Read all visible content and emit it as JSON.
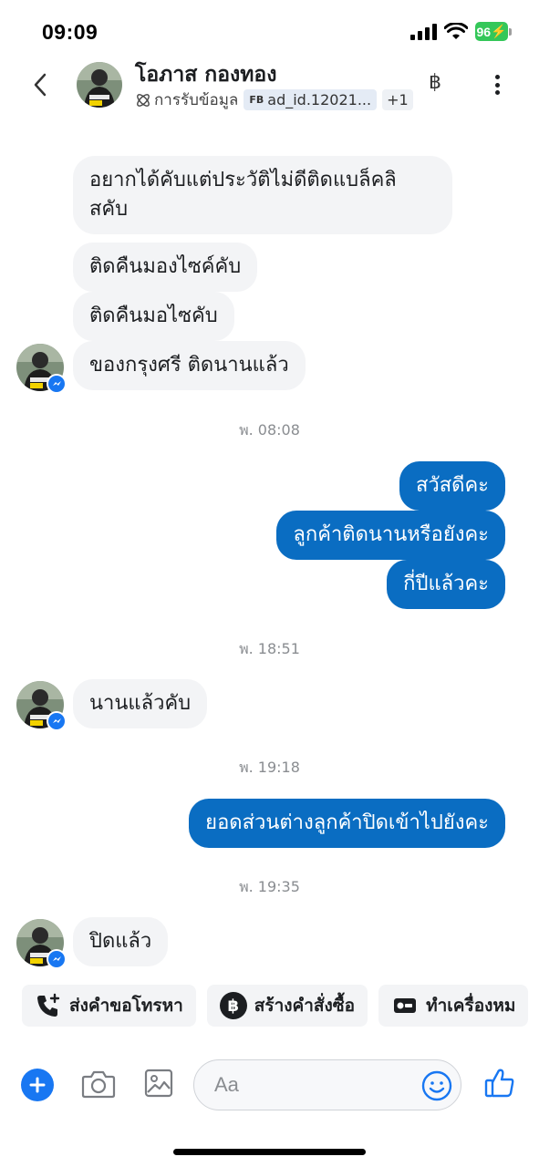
{
  "status_bar": {
    "time": "09:09",
    "battery": "96"
  },
  "header": {
    "contact_name": "โอภาส กองทอง",
    "info_label": "การรับข้อมูล",
    "tag_prefix": "FB",
    "tag_text": "ad_id.12021...",
    "extra_count": "+1",
    "currency_icon": "฿"
  },
  "messages": [
    {
      "side": "in",
      "text_line1": "อยากได้คับแต่ประวัติไม่ดีติดแบล็คลิ",
      "text_line2": "สคับ"
    },
    {
      "side": "in",
      "text": "ติดคืนมองไซค์คับ"
    },
    {
      "side": "in",
      "text": "ติดคืนมอไซคับ"
    },
    {
      "side": "in",
      "text": "ของกรุงศรี ติดนานแล้ว"
    },
    {
      "side": "out",
      "text": "สวัสดีคะ"
    },
    {
      "side": "out",
      "text": "ลูกค้าติดนานหรือยังคะ"
    },
    {
      "side": "out",
      "text": "กี่ปีแล้วคะ"
    },
    {
      "side": "in",
      "text": "นานแล้วคับ"
    },
    {
      "side": "out",
      "text": "ยอดส่วนต่างลูกค้าปิดเข้าไปยังคะ"
    },
    {
      "side": "in",
      "text": "ปิดแล้ว"
    }
  ],
  "timestamps": [
    "พ. 08:08",
    "พ. 18:51",
    "พ. 19:18",
    "พ. 19:35"
  ],
  "quick_actions": [
    {
      "label": "ส่งคำขอโทรหา",
      "icon": "phone-add-icon"
    },
    {
      "label": "สร้างคำสั่งซื้อ",
      "icon": "baht-icon",
      "icon_text": "฿"
    },
    {
      "label": "ทำเครื่องหม",
      "icon": "tag-card-icon"
    }
  ],
  "composer": {
    "placeholder": "Aa"
  },
  "colors": {
    "outgoing": "#0a6dc2",
    "incoming": "#f3f4f6",
    "accent": "#1877f2"
  }
}
